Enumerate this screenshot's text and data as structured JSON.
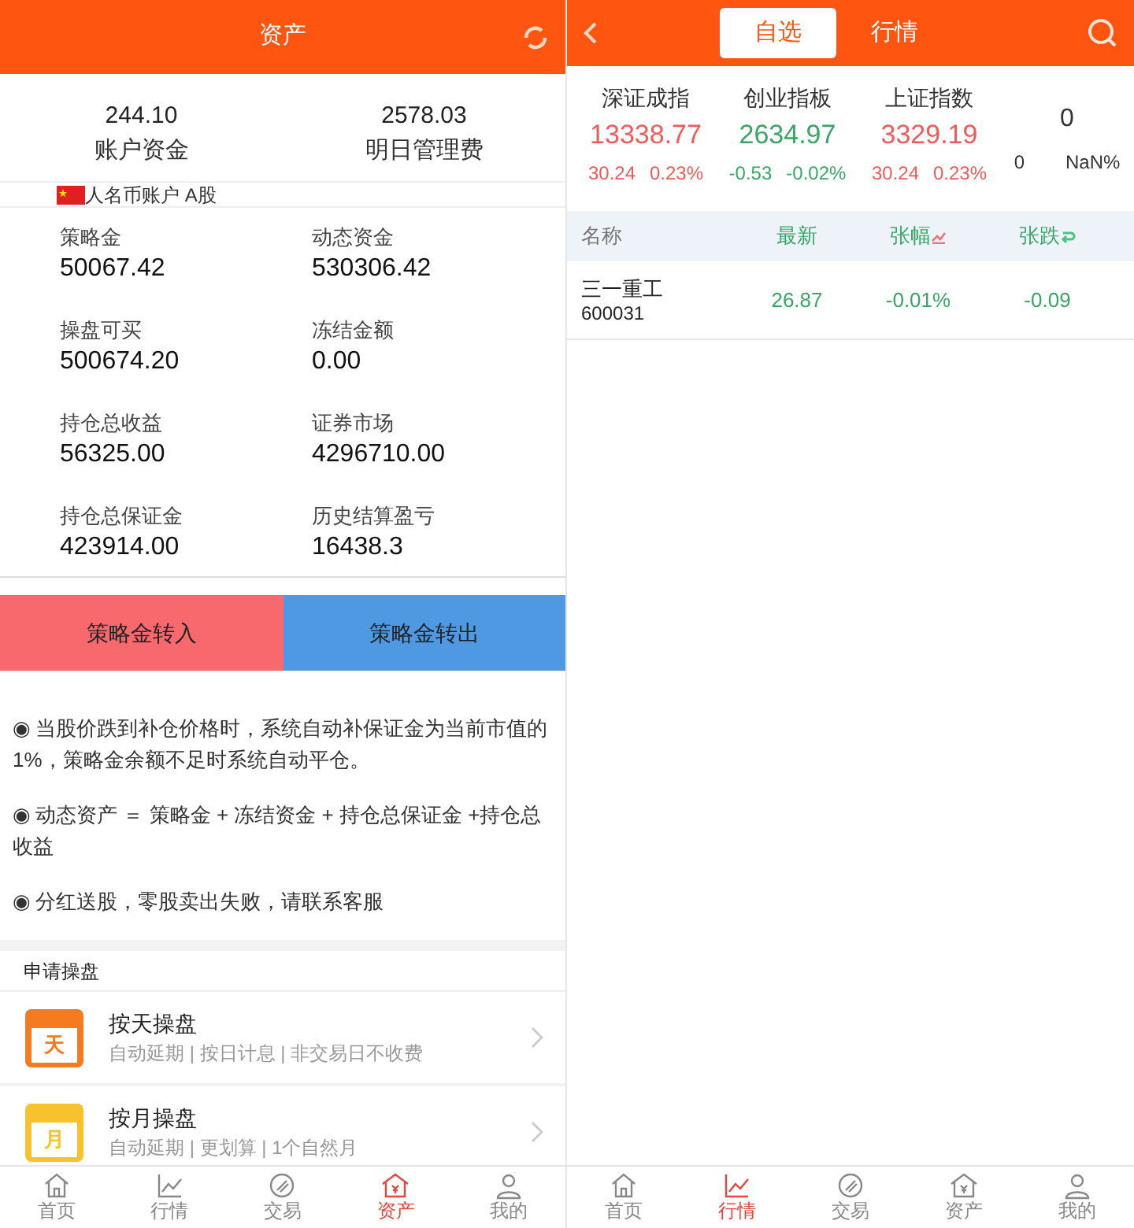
{
  "assets_screen": {
    "header": {
      "title": "资产"
    },
    "summary": [
      {
        "value": "244.10",
        "label": "账户资金"
      },
      {
        "value": "2578.03",
        "label": "明日管理费"
      }
    ],
    "account": {
      "label": "人名币账户 A股"
    },
    "fields": [
      {
        "label": "策略金",
        "value": "50067.42"
      },
      {
        "label": "动态资金",
        "value": "530306.42"
      },
      {
        "label": "操盘可买",
        "value": "500674.20"
      },
      {
        "label": "冻结金额",
        "value": "0.00"
      },
      {
        "label": "持仓总收益",
        "value": "56325.00"
      },
      {
        "label": "证券市场",
        "value": "4296710.00"
      },
      {
        "label": "持仓总保证金",
        "value": "423914.00"
      },
      {
        "label": "历史结算盈亏",
        "value": "16438.3"
      }
    ],
    "actions": [
      {
        "label": "策略金转入",
        "kind": "in"
      },
      {
        "label": "策略金转出",
        "kind": "out"
      }
    ],
    "notes": [
      "◉ 当股价跌到补仓价格时，系统自动补保证金为当前市值的1%，策略金余额不足时系统自动平仓。",
      "◉  动态资产 ＝ 策略金 + 冻结资金 + 持仓总保证金 +持仓总收益",
      "◉ 分红送股，零股卖出失败，请联系客服"
    ],
    "plans_title": "申请操盘",
    "plans": [
      {
        "icon_text": "天",
        "color": "#f47b20",
        "title": "按天操盘",
        "subtitle": "自动延期 | 按日计息 | 非交易日不收费"
      },
      {
        "icon_text": "月",
        "color": "#f8c22e",
        "title": "按月操盘",
        "subtitle": "自动延期 | 更划算 | 1个自然月"
      }
    ],
    "tab_bar": [
      {
        "label": "首页",
        "selected": false
      },
      {
        "label": "行情",
        "selected": false
      },
      {
        "label": "交易",
        "selected": false
      },
      {
        "label": "资产",
        "selected": true
      },
      {
        "label": "我的",
        "selected": false
      }
    ]
  },
  "market_screen": {
    "header": {
      "tabs": [
        {
          "label": "自选",
          "selected": true
        },
        {
          "label": "行情",
          "selected": false
        }
      ]
    },
    "indices": [
      {
        "name": "深证成指",
        "price": "13338.77",
        "change": "30.24",
        "percent": "0.23%",
        "color": "#f05a5a"
      },
      {
        "name": "创业指板",
        "price": "2634.97",
        "change": "-0.53",
        "percent": "-0.02%",
        "color": "#3aa566"
      },
      {
        "name": "上证指数",
        "price": "3329.19",
        "change": "30.24",
        "percent": "0.23%",
        "color": "#f05a5a"
      }
    ],
    "extra_index": {
      "price": "0",
      "change": "0",
      "percent": "NaN%"
    },
    "table": {
      "columns": [
        "名称",
        "最新",
        "张幅",
        "张跌"
      ],
      "rows": [
        {
          "name": "三一重工",
          "code": "600031",
          "latest": "26.87",
          "change_percent": "-0.01%",
          "change": "-0.09",
          "color": "#3aa566"
        }
      ]
    },
    "tab_bar": [
      {
        "label": "首页",
        "selected": false
      },
      {
        "label": "行情",
        "selected": true
      },
      {
        "label": "交易",
        "selected": false
      },
      {
        "label": "资产",
        "selected": false
      },
      {
        "label": "我的",
        "selected": false
      }
    ]
  }
}
